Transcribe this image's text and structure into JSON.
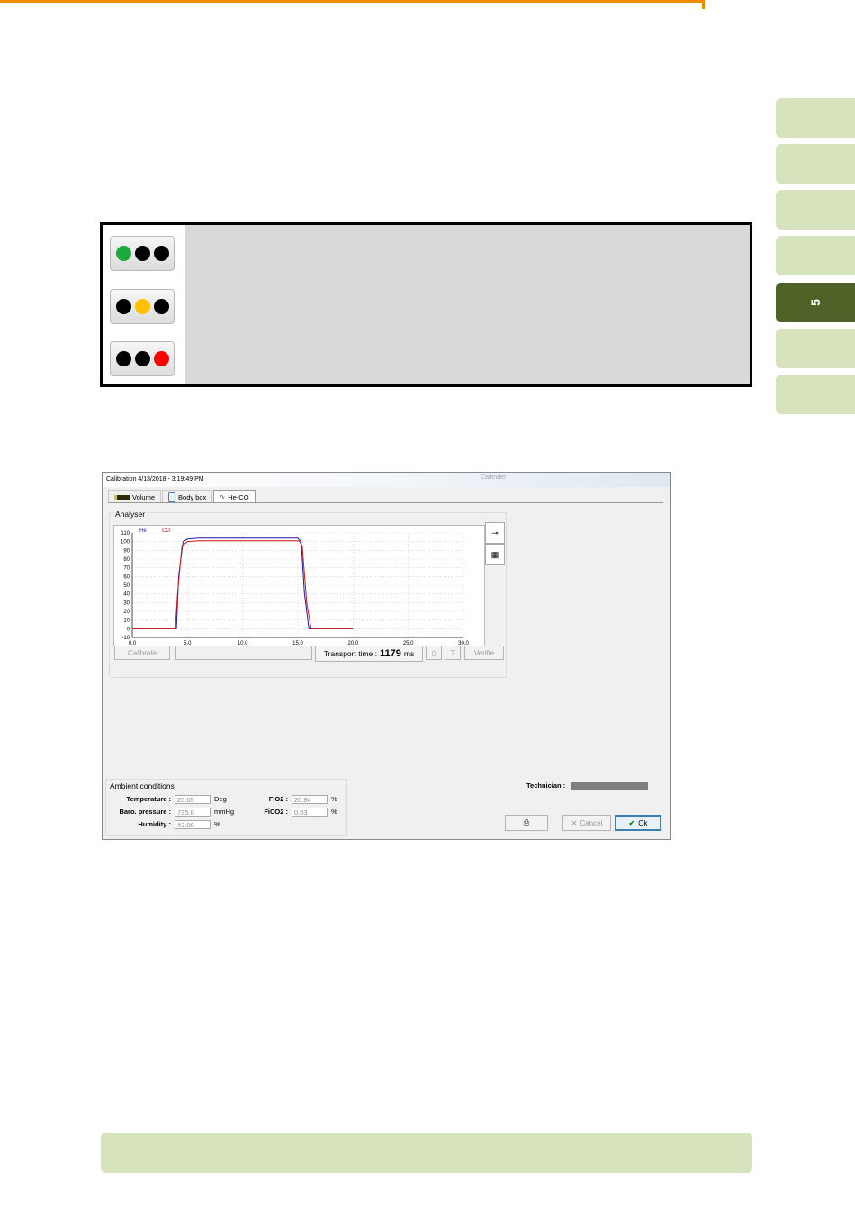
{
  "side_tabs": [
    "",
    "",
    "",
    "",
    "5",
    "",
    ""
  ],
  "status_lights": [
    {
      "colors": [
        "green",
        "black",
        "black"
      ]
    },
    {
      "colors": [
        "black",
        "yellow",
        "black"
      ]
    },
    {
      "colors": [
        "black",
        "black",
        "red"
      ]
    }
  ],
  "colors": {
    "green": "#1caa3d",
    "yellow": "#ffc200",
    "red": "#ff0000",
    "he_line": "#1a1aa8",
    "co_line": "#d01818",
    "accent": "#f08a00",
    "tab_green": "#d6e3bc",
    "tab_active": "#4f6228"
  },
  "dialog": {
    "title": "Calibration 4/13/2018 - 3:19:49 PM",
    "ghost_title": "Calender",
    "tabs": [
      {
        "label": "Volume",
        "icon": "battery-icon"
      },
      {
        "label": "Body box",
        "icon": "body-box-icon"
      },
      {
        "label": "He-CO",
        "icon": "wave-icon"
      }
    ],
    "analyser_label": "Analyser",
    "calibrate_label": "Calibrate",
    "transport_label": "Transport time :",
    "transport_value": "1179",
    "transport_unit": "ms",
    "verify_label": "Verifie",
    "ambient": {
      "label": "Ambient conditions",
      "temperature_label": "Temperature :",
      "temperature_value": "25.05",
      "temperature_unit": "Deg",
      "baro_label": "Baro. pressure :",
      "baro_value": "735.0",
      "baro_unit": "mmHg",
      "humidity_label": "Humidity :",
      "humidity_value": "42.00",
      "humidity_unit": "%",
      "fio2_label": "FIO2 :",
      "fio2_value": "20.94",
      "fio2_unit": "%",
      "fico2_label": "FiCO2 :",
      "fico2_value": "0.03",
      "fico2_unit": "%"
    },
    "technician_label": "Technician :",
    "cancel_label": "Cancel",
    "ok_label": "Ok"
  },
  "chart_data": {
    "type": "line",
    "x_ticks": [
      "0.0",
      "5.0",
      "10.0",
      "15.0",
      "20.0",
      "25.0",
      "30.0"
    ],
    "y_ticks": [
      "-10",
      "0",
      "10",
      "20",
      "30",
      "40",
      "50",
      "60",
      "70",
      "80",
      "90",
      "100",
      "110"
    ],
    "xlim": [
      0,
      30
    ],
    "ylim": [
      -10,
      110
    ],
    "grid": true,
    "legend": [
      "He",
      "CO"
    ],
    "series": [
      {
        "name": "He",
        "color": "#1a1aa8",
        "x": [
          0,
          4.0,
          4.2,
          4.6,
          5.0,
          6,
          15.0,
          15.3,
          15.6,
          16.0,
          20
        ],
        "y": [
          0,
          0,
          60,
          100,
          103,
          104,
          104,
          100,
          40,
          0,
          0
        ]
      },
      {
        "name": "CO",
        "color": "#d01818",
        "x": [
          0,
          3.9,
          4.1,
          4.5,
          5.0,
          6,
          15.1,
          15.4,
          15.8,
          16.2,
          20
        ],
        "y": [
          0,
          0,
          40,
          95,
          100,
          101,
          101,
          95,
          30,
          0,
          0
        ]
      }
    ]
  }
}
